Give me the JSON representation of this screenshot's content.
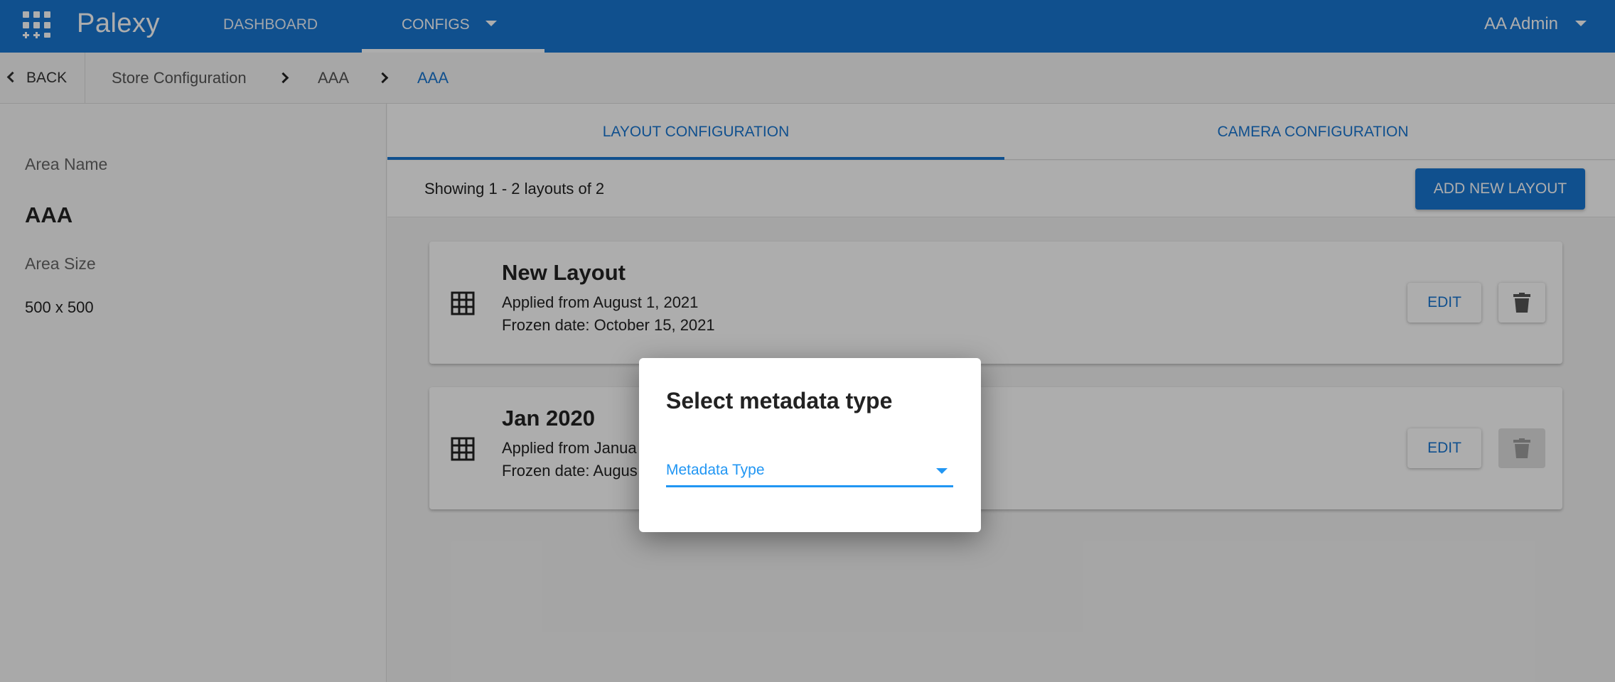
{
  "app": {
    "brand": "Palexy",
    "nav": [
      {
        "label": "DASHBOARD"
      },
      {
        "label": "CONFIGS"
      }
    ],
    "user": "AA Admin"
  },
  "breadcrumb": {
    "back": "BACK",
    "items": [
      "Store Configuration",
      "AAA",
      "AAA"
    ]
  },
  "area": {
    "name_label": "Area Name",
    "name": "AAA",
    "size_label": "Area Size",
    "size": "500 x 500"
  },
  "tabs": [
    {
      "label": "LAYOUT CONFIGURATION",
      "active": true
    },
    {
      "label": "CAMERA CONFIGURATION",
      "active": false
    }
  ],
  "layouts_header": {
    "showing": "Showing 1 - 2 layouts of 2",
    "add_button": "ADD NEW LAYOUT"
  },
  "layouts": [
    {
      "title": "New Layout",
      "applied": "Applied from August 1, 2021",
      "frozen": "Frozen date: October 15, 2021",
      "edit": "EDIT",
      "delete_disabled": false
    },
    {
      "title": "Jan 2020",
      "applied": "Applied from Janua",
      "frozen": "Frozen date: Augus",
      "edit": "EDIT",
      "delete_disabled": true
    }
  ],
  "dialog": {
    "title": "Select metadata type",
    "select_label": "Metadata Type"
  },
  "colors": {
    "primary": "#1976d2",
    "focus": "#2196f3",
    "overlay": "rgba(0,0,0,0.32)"
  }
}
